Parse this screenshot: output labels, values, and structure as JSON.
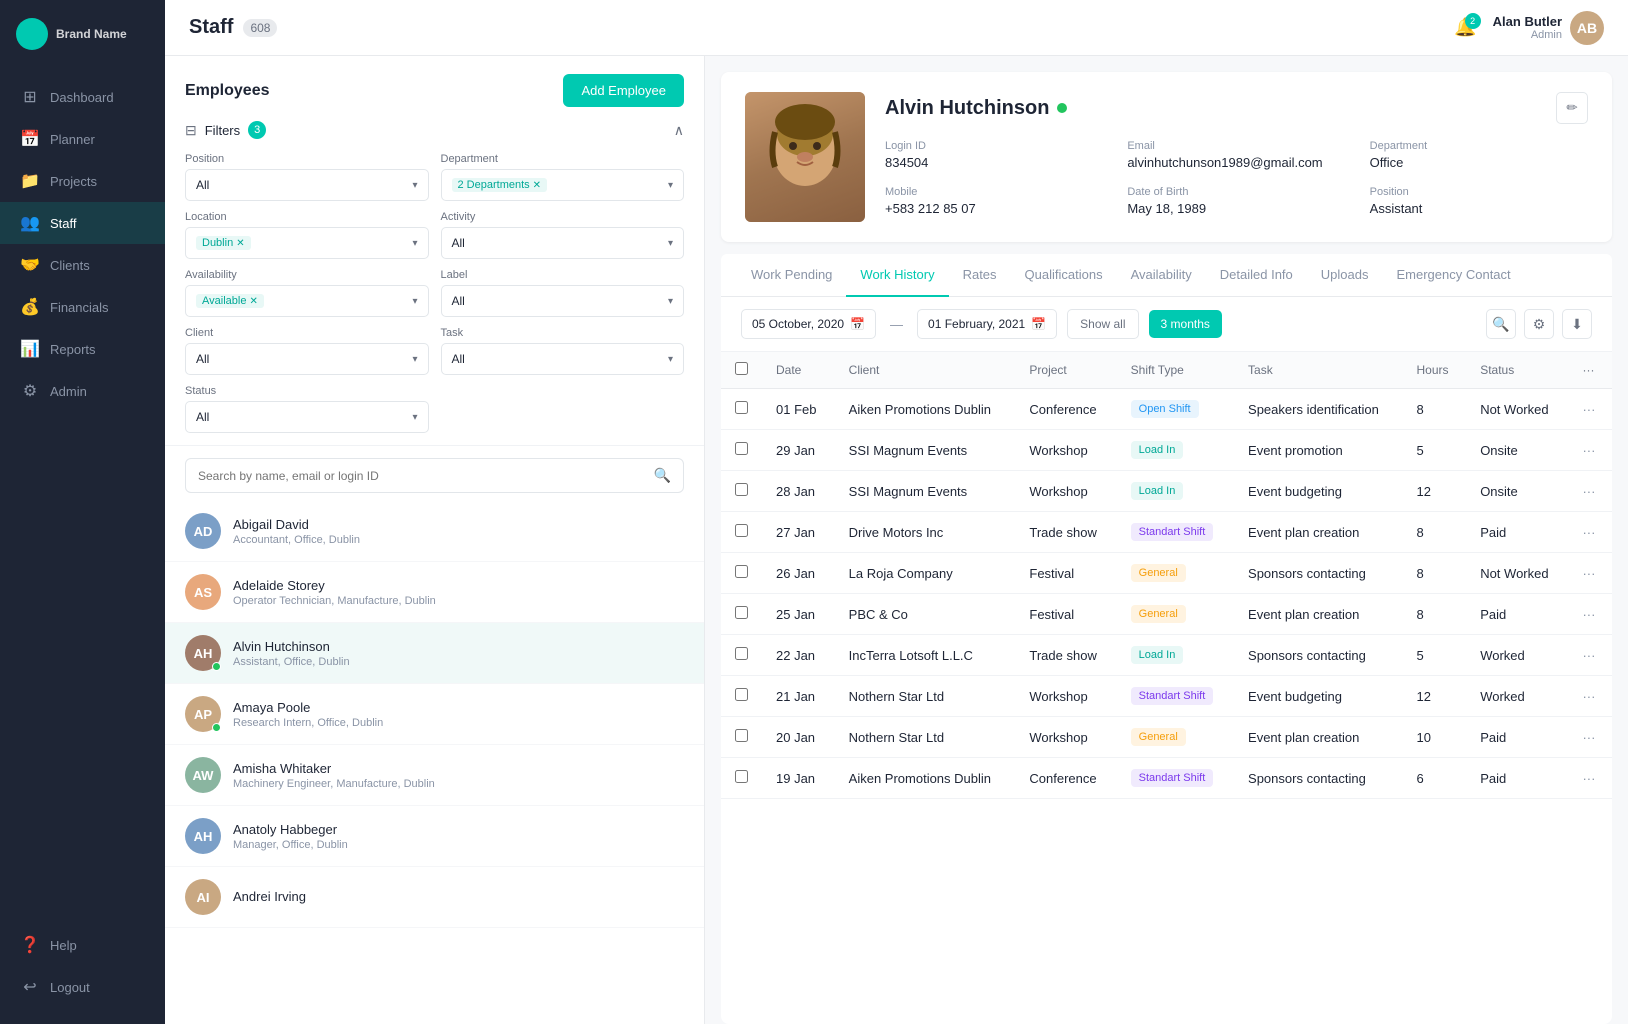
{
  "sidebar": {
    "logo_text": "Brand Name",
    "nav_items": [
      {
        "id": "dashboard",
        "label": "Dashboard",
        "icon": "⊞",
        "active": false
      },
      {
        "id": "planner",
        "label": "Planner",
        "icon": "📅",
        "active": false
      },
      {
        "id": "projects",
        "label": "Projects",
        "icon": "📁",
        "active": false
      },
      {
        "id": "staff",
        "label": "Staff",
        "icon": "👥",
        "active": true
      },
      {
        "id": "clients",
        "label": "Clients",
        "icon": "🤝",
        "active": false
      },
      {
        "id": "financials",
        "label": "Financials",
        "icon": "💰",
        "active": false
      },
      {
        "id": "reports",
        "label": "Reports",
        "icon": "📊",
        "active": false
      },
      {
        "id": "admin",
        "label": "Admin",
        "icon": "⚙",
        "active": false
      }
    ],
    "bottom_items": [
      {
        "id": "help",
        "label": "Help",
        "icon": "❓"
      },
      {
        "id": "logout",
        "label": "Logout",
        "icon": "↩"
      }
    ]
  },
  "header": {
    "title": "Staff",
    "count": "608",
    "notification_count": "2",
    "user": {
      "name": "Alan Butler",
      "role": "Admin"
    }
  },
  "employees_panel": {
    "title": "Employees",
    "add_button": "Add Employee",
    "filters_label": "Filters",
    "filter_count": "3",
    "filters": {
      "position_label": "Position",
      "position_value": "All",
      "department_label": "Department",
      "department_value": "2 Departments",
      "location_label": "Location",
      "location_value": "Dublin",
      "activity_label": "Activity",
      "activity_value": "All",
      "availability_label": "Availability",
      "availability_value": "Available",
      "label_label": "Label",
      "label_value": "All",
      "client_label": "Client",
      "client_value": "All",
      "task_label": "Task",
      "task_value": "All",
      "status_label": "Status",
      "status_value": "All"
    },
    "search_placeholder": "Search by name, email or login ID",
    "employees": [
      {
        "id": 1,
        "name": "Abigail David",
        "detail": "Accountant, Office, Dublin",
        "initials": "AD",
        "color": "#7b9fc7",
        "online": false
      },
      {
        "id": 2,
        "name": "Adelaide Storey",
        "detail": "Operator Technician, Manufacture, Dublin",
        "initials": "AS",
        "color": "#e8a87c",
        "online": false
      },
      {
        "id": 3,
        "name": "Alvin Hutchinson",
        "detail": "Assistant, Office, Dublin",
        "initials": "AH",
        "color": "#a07c6a",
        "online": true,
        "active": true
      },
      {
        "id": 4,
        "name": "Amaya Poole",
        "detail": "Research Intern, Office, Dublin",
        "initials": "AP",
        "color": "#c9a882",
        "online": true
      },
      {
        "id": 5,
        "name": "Amisha Whitaker",
        "detail": "Machinery Engineer, Manufacture, Dublin",
        "initials": "AW",
        "color": "#8ab5a0",
        "online": false
      },
      {
        "id": 6,
        "name": "Anatoly Habbeger",
        "detail": "Manager, Office, Dublin",
        "initials": "AH",
        "color": "#7b9fc7",
        "online": false
      },
      {
        "id": 7,
        "name": "Andrei Irving",
        "detail": "",
        "initials": "AI",
        "color": "#c9a882",
        "online": false
      }
    ]
  },
  "employee_detail": {
    "name": "Alvin Hutchinson",
    "status": "online",
    "login_id_label": "Login ID",
    "login_id": "834504",
    "email_label": "Email",
    "email": "alvinhutchunson1989@gmail.com",
    "department_label": "Department",
    "department": "Office",
    "mobile_label": "Mobile",
    "mobile": "+583 212 85 07",
    "dob_label": "Date of Birth",
    "dob": "May 18, 1989",
    "position_label": "Position",
    "position": "Assistant",
    "tabs": [
      {
        "id": "work-pending",
        "label": "Work Pending",
        "active": false
      },
      {
        "id": "work-history",
        "label": "Work History",
        "active": true
      },
      {
        "id": "rates",
        "label": "Rates",
        "active": false
      },
      {
        "id": "qualifications",
        "label": "Qualifications",
        "active": false
      },
      {
        "id": "availability",
        "label": "Availability",
        "active": false
      },
      {
        "id": "detailed-info",
        "label": "Detailed Info",
        "active": false
      },
      {
        "id": "uploads",
        "label": "Uploads",
        "active": false
      },
      {
        "id": "emergency-contact",
        "label": "Emergency Contact",
        "active": false
      }
    ],
    "work_history": {
      "date_from": "05 October, 2020",
      "date_to": "01 February, 2021",
      "show_all_label": "Show all",
      "period_label": "3 months",
      "table_headers": [
        "",
        "Date",
        "Client",
        "Project",
        "Shift Type",
        "Task",
        "Hours",
        "Status",
        ""
      ],
      "rows": [
        {
          "date": "01 Feb",
          "client": "Aiken Promotions Dublin",
          "project": "Conference",
          "shift_type": "Open Shift",
          "shift_class": "badge-open-shift",
          "task": "Speakers identification",
          "hours": "8",
          "status": "Not Worked"
        },
        {
          "date": "29 Jan",
          "client": "SSI Magnum Events",
          "project": "Workshop",
          "shift_type": "Load In",
          "shift_class": "badge-load-in",
          "task": "Event promotion",
          "hours": "5",
          "status": "Onsite"
        },
        {
          "date": "28 Jan",
          "client": "SSI Magnum Events",
          "project": "Workshop",
          "shift_type": "Load In",
          "shift_class": "badge-load-in",
          "task": "Event budgeting",
          "hours": "12",
          "status": "Onsite"
        },
        {
          "date": "27 Jan",
          "client": "Drive Motors Inc",
          "project": "Trade show",
          "shift_type": "Standart Shift",
          "shift_class": "badge-standard-shift",
          "task": "Event plan creation",
          "hours": "8",
          "status": "Paid"
        },
        {
          "date": "26 Jan",
          "client": "La Roja Company",
          "project": "Festival",
          "shift_type": "General",
          "shift_class": "badge-general",
          "task": "Sponsors contacting",
          "hours": "8",
          "status": "Not Worked"
        },
        {
          "date": "25 Jan",
          "client": "PBC & Co",
          "project": "Festival",
          "shift_type": "General",
          "shift_class": "badge-general",
          "task": "Event plan creation",
          "hours": "8",
          "status": "Paid"
        },
        {
          "date": "22 Jan",
          "client": "IncTerra Lotsoft L.L.C",
          "project": "Trade show",
          "shift_type": "Load In",
          "shift_class": "badge-load-in",
          "task": "Sponsors contacting",
          "hours": "5",
          "status": "Worked"
        },
        {
          "date": "21 Jan",
          "client": "Nothern Star Ltd",
          "project": "Workshop",
          "shift_type": "Standart Shift",
          "shift_class": "badge-standard-shift",
          "task": "Event budgeting",
          "hours": "12",
          "status": "Worked"
        },
        {
          "date": "20 Jan",
          "client": "Nothern Star Ltd",
          "project": "Workshop",
          "shift_type": "General",
          "shift_class": "badge-general",
          "task": "Event plan creation",
          "hours": "10",
          "status": "Paid"
        },
        {
          "date": "19 Jan",
          "client": "Aiken Promotions Dublin",
          "project": "Conference",
          "shift_type": "Standart Shift",
          "shift_class": "badge-standard-shift",
          "task": "Sponsors contacting",
          "hours": "6",
          "status": "Paid"
        }
      ]
    }
  }
}
